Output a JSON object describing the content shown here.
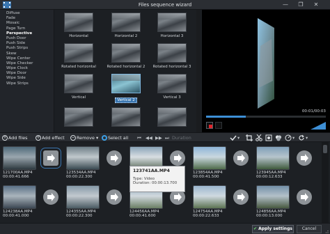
{
  "window": {
    "title": "Files sequence wizard",
    "minimize": "—",
    "maximize": "❐",
    "close": "✕"
  },
  "transitions": [
    "Diffuse",
    "Fade",
    "Mosaic",
    "Page Turn",
    "Perspective",
    "Push Door",
    "Push Side",
    "Push Strips",
    "Skew",
    "Wipe Center",
    "Wipe Checker",
    "Wipe Clock",
    "Wipe Door",
    "Wipe Side",
    "Wipe Strips"
  ],
  "transitions_selected": "Perspective",
  "previews": [
    {
      "label": "Horizontal"
    },
    {
      "label": "Horizontal 2"
    },
    {
      "label": "Horizontal 3"
    },
    {
      "label": "Rotated horizontal"
    },
    {
      "label": "Rotated horizontal 2"
    },
    {
      "label": "Rotated horizontal 3"
    },
    {
      "label": "Vertical"
    },
    {
      "label": "Vertical 2",
      "selected": true
    },
    {
      "label": "Vertical 3"
    },
    {
      "label": ""
    },
    {
      "label": ""
    },
    {
      "label": ""
    }
  ],
  "player": {
    "time": "00:01/00:03",
    "progress": 0.33
  },
  "toolbar": {
    "add_files": "Add files",
    "add_effect": "Add effect",
    "remove": "Remove",
    "select_all": "Select all",
    "duration": "Duration"
  },
  "clips": [
    {
      "name": "121700AA.MP4",
      "duration": "00:00:41.666"
    },
    {
      "name": "123534AA.MP4",
      "duration": "00:00:22.300"
    },
    {
      "name": "123741AA.MP4",
      "duration": ""
    },
    {
      "name": "123854AA.MP4",
      "duration": "00:00:41.500"
    },
    {
      "name": "123945AA.MP4",
      "duration": "00:00:12.633"
    },
    {
      "name": "124238AA.MP4",
      "duration": "00:00:41.000"
    },
    {
      "name": "124355AA.MP4",
      "duration": "00:00:22.300"
    },
    {
      "name": "124456AA.MP4",
      "duration": "00:00:41.600"
    },
    {
      "name": "124754AA.MP4",
      "duration": "00:00:22.633"
    },
    {
      "name": "124856AA.MP4",
      "duration": "00:00:13.000"
    }
  ],
  "tooltip": {
    "title": "123741AA.MP4",
    "type_line": "Type: Video",
    "duration_line": "Duration: 00:00:13.700"
  },
  "footer": {
    "apply": "Apply settings",
    "cancel": "Cancel"
  },
  "colors": {
    "accent": "#3a76b0",
    "record": "#e0242b",
    "progress": "#3d8fd6"
  }
}
